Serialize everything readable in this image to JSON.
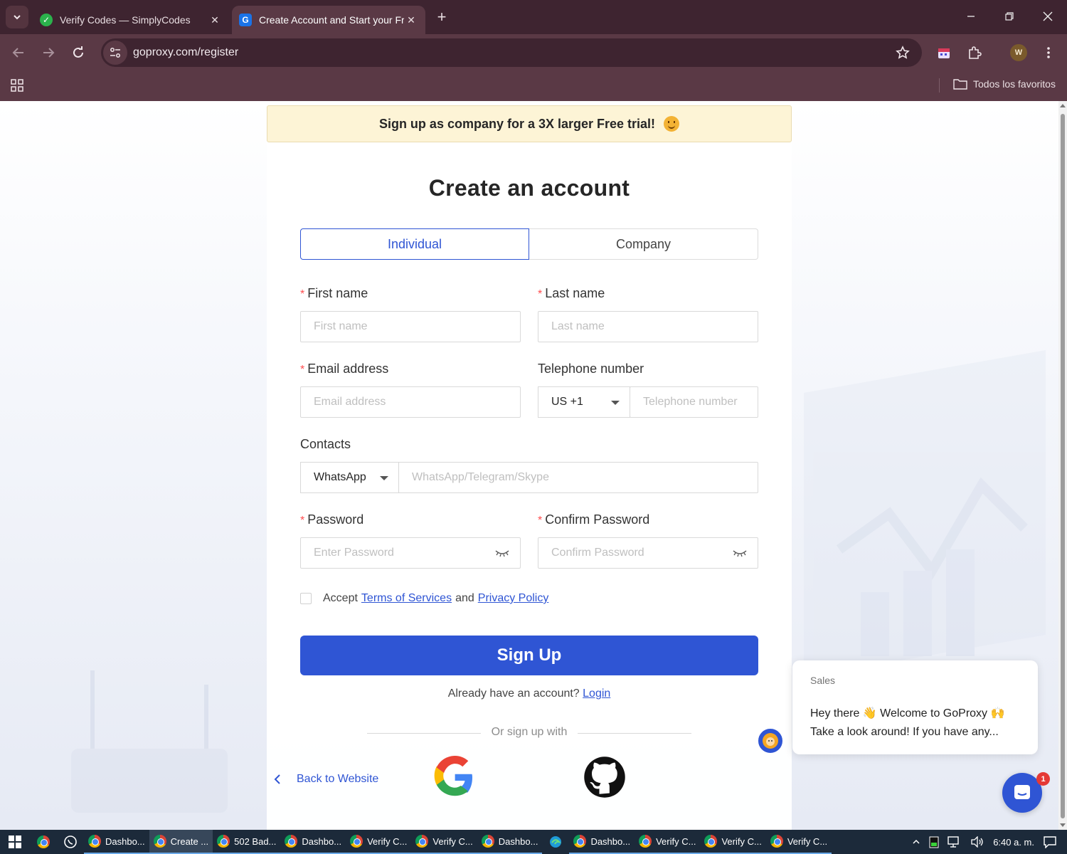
{
  "browser": {
    "tabs": [
      {
        "title": "Verify Codes — SimplyCodes",
        "active": false
      },
      {
        "title": "Create Account and Start your Free Trial",
        "active": true
      }
    ],
    "url": "goproxy.com/register",
    "profile_initial": "W",
    "bookmarks_label": "Todos los favoritos"
  },
  "page": {
    "banner": "Sign up as company for a 3X larger Free trial!",
    "title": "Create an account",
    "account_types": [
      "Individual",
      "Company"
    ],
    "selected_account_type": "Individual",
    "fields": {
      "first_name": {
        "label": "First name",
        "placeholder": "First name",
        "required": "*"
      },
      "last_name": {
        "label": "Last name",
        "placeholder": "Last name",
        "required": "*"
      },
      "email": {
        "label": "Email address",
        "placeholder": "Email address",
        "required": "*"
      },
      "telephone": {
        "label": "Telephone number",
        "placeholder": "Telephone number",
        "country_code": "US +1"
      },
      "contacts": {
        "label": "Contacts",
        "method": "WhatsApp",
        "placeholder": "WhatsApp/Telegram/Skype"
      },
      "password": {
        "label": "Password",
        "placeholder": "Enter Password",
        "required": "*"
      },
      "confirm_password": {
        "label": "Confirm Password",
        "placeholder": "Confirm Password",
        "required": "*"
      }
    },
    "terms": {
      "accept": "Accept",
      "terms_link": "Terms of Services",
      "and": "and",
      "privacy_link": "Privacy Policy"
    },
    "signup_button": "Sign Up",
    "already_text": "Already have an account?",
    "login_link": "Login",
    "or_sign_up_with": "Or sign up with",
    "back_link": "Back to Website",
    "accent_color": "#2f55d4"
  },
  "chat": {
    "from": "Sales",
    "line1": "Hey there 👋 Welcome to GoProxy 🙌",
    "line2": "Take a look around! If you have any...",
    "badge_count": "1"
  },
  "taskbar": {
    "apps": [
      {
        "label": "Dashbo..."
      },
      {
        "label": "Create ...",
        "active": true
      },
      {
        "label": "502 Bad..."
      },
      {
        "label": "Dashbo..."
      },
      {
        "label": "Verify C..."
      },
      {
        "label": "Verify C..."
      },
      {
        "label": "Dashbo..."
      },
      {
        "label": "Dashbo..."
      },
      {
        "label": "Verify C..."
      },
      {
        "label": "Verify C..."
      },
      {
        "label": "Verify C..."
      }
    ],
    "clock": "6:40 a. m."
  }
}
